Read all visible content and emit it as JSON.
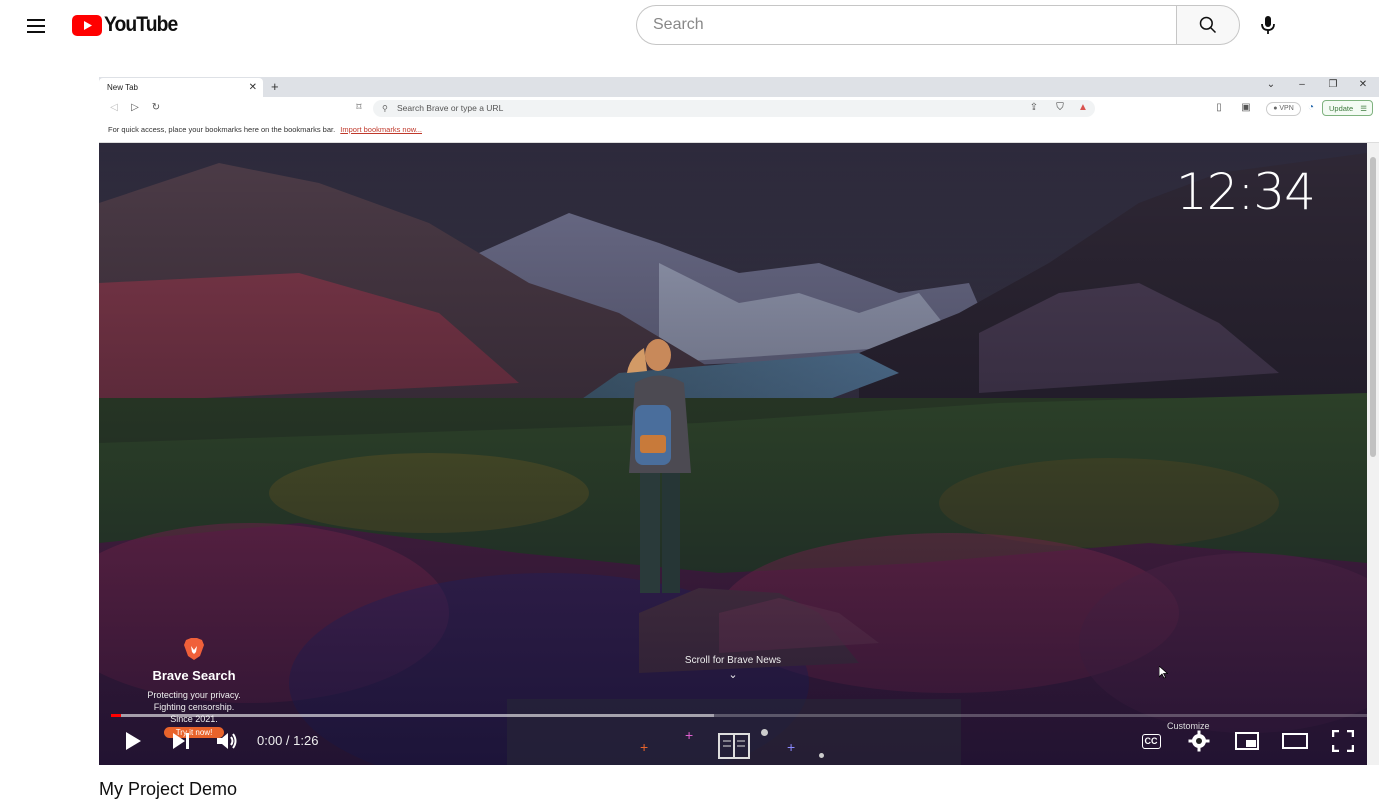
{
  "header": {
    "logo_text": "YouTube",
    "search_placeholder": "Search",
    "brand_red": "#ff0000"
  },
  "browser": {
    "tab_title": "New Tab",
    "omnibox_placeholder": "Search Brave or type a URL",
    "vpn_label": "VPN",
    "update_label": "Update",
    "bookmarks_prompt": "For quick access, place your bookmarks here on the bookmarks bar.",
    "bookmarks_link": "Import bookmarks now..."
  },
  "newtab": {
    "clock": "12:34",
    "brave_title": "Brave Search",
    "brave_tagline": [
      "Protecting your privacy.",
      "Fighting censorship.",
      "Since 2021."
    ],
    "brave_cta": "Try it now!",
    "scroll_hint": "Scroll for Brave News"
  },
  "player": {
    "current_time": "0:00",
    "duration": "1:26",
    "time_separator": " / ",
    "played_fraction": 0.0,
    "buffered_fraction": 0.48,
    "customize_label": "Customize",
    "cc_label": "CC"
  },
  "video": {
    "title": "My Project Demo"
  }
}
